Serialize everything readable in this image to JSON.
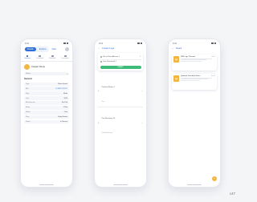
{
  "phone1": {
    "status_time": "9:41",
    "tabs": [
      "Details",
      "Explore"
    ],
    "view_label": "View",
    "nav": [
      "Overview",
      "Scheduled",
      "Workload",
      "Documents"
    ],
    "profile_name": "Caspar Stone",
    "status_label": "Status",
    "section_title": "General",
    "rows": [
      {
        "k": "Type",
        "v": "Water Vessel"
      },
      {
        "k": "IMO",
        "v": "IS 8RPOYXXXT"
      },
      {
        "k": "Flag",
        "v": "Malta"
      },
      {
        "k": "Year",
        "v": "2020"
      },
      {
        "k": "Manufacturer",
        "v": "Ste Ped"
      },
      {
        "k": "Beam",
        "v": "1.33m"
      },
      {
        "k": "Model",
        "v": "1.4m"
      },
      {
        "k": "Flag",
        "v": "United States"
      },
      {
        "k": "Status",
        "v": "In Service"
      }
    ]
  },
  "phone2": {
    "status_time": "9:41",
    "title": "Create Logs",
    "locations": [
      "Port of Saint Abrams 1",
      "Lake Rosewood 1"
    ],
    "start_label": "START",
    "history": [
      {
        "t": "Portland Station 1",
        "s": "2hrs"
      },
      {
        "t": "Port Rosemary 16",
        "s": "Central Basin port"
      }
    ]
  },
  "phone3": {
    "status_time": "9:41",
    "title": "Notes",
    "docs": [
      {
        "title": "WM Logs Planned",
        "date": "Feb 1"
      },
      {
        "title": "Updated Schedule Notes",
        "date": "Jan 15"
      }
    ],
    "fab": "+"
  },
  "watermark": "c47"
}
